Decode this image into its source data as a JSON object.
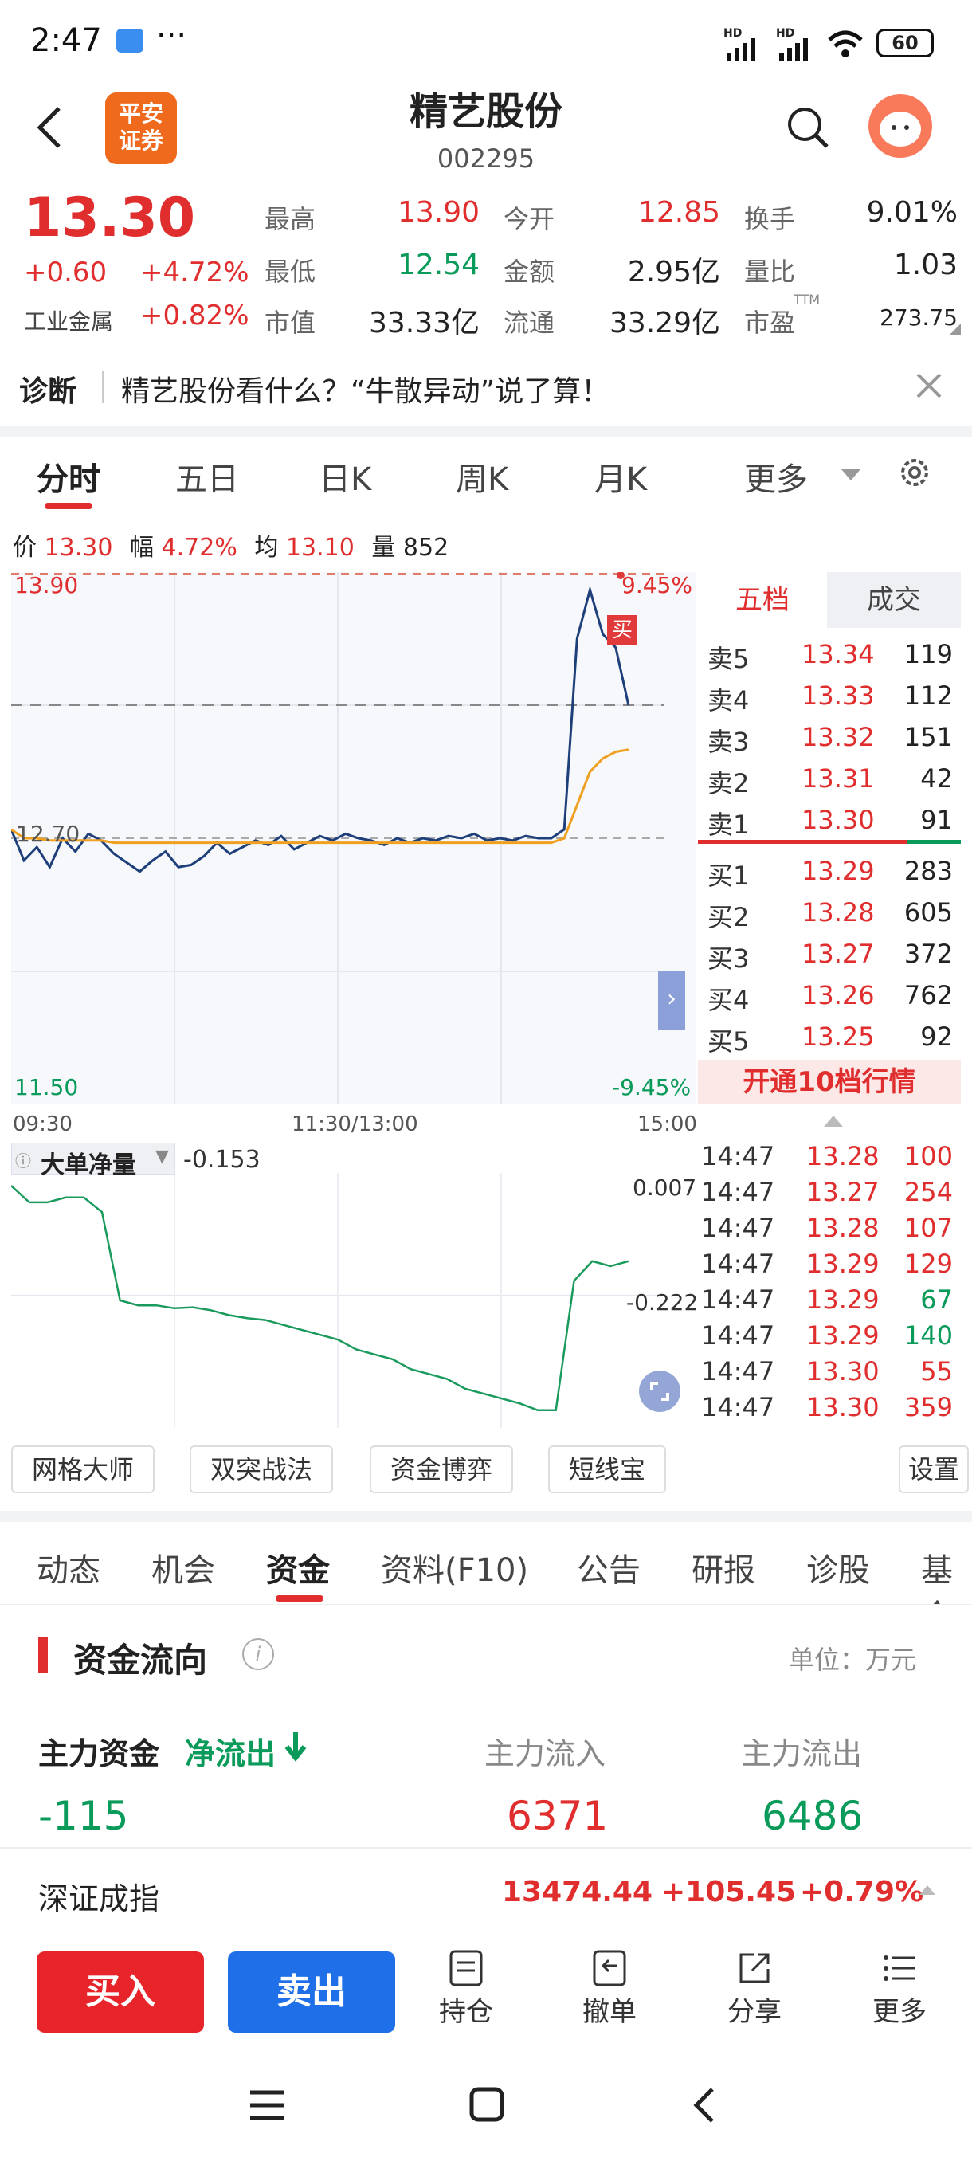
{
  "status": {
    "time": "2:47",
    "battery": "60",
    "dots": "···",
    "hd1": "HD",
    "hd2": "HD"
  },
  "header": {
    "logo_line1": "平安",
    "logo_line2": "证券",
    "name": "精艺股份",
    "code": "002295"
  },
  "quote": {
    "price": "13.30",
    "change": "+0.60",
    "change_pct": "+4.72%",
    "sector": "工业金属",
    "sector_pct": "+0.82%",
    "high_label": "最高",
    "high": "13.90",
    "open_label": "今开",
    "open": "12.85",
    "turnover_label": "换手",
    "turnover": "9.01%",
    "low_label": "最低",
    "low": "12.54",
    "amount_label": "金额",
    "amount": "2.95亿",
    "vr_label": "量比",
    "vr": "1.03",
    "mcap_label": "市值",
    "mcap": "33.33亿",
    "float_label": "流通",
    "float": "33.29亿",
    "pe_label": "市盈",
    "pe_sup": "TTM",
    "pe": "273.75"
  },
  "diag": {
    "label": "诊断",
    "text": "精艺股份看什么？“牛散异动”说了算！"
  },
  "chart_tabs": [
    "分时",
    "五日",
    "日K",
    "周K",
    "月K",
    "更多"
  ],
  "info_line": {
    "price_label": "价",
    "price": "13.30",
    "amp_label": "幅",
    "amp": "4.72%",
    "avg_label": "均",
    "avg": "13.10",
    "vol_label": "量",
    "vol": "852"
  },
  "chart_data": {
    "type": "line",
    "title": "",
    "y_top": "13.90",
    "y_mid": "12.70",
    "y_bottom": "11.50",
    "pct_top": "9.45%",
    "pct_bottom": "-9.45%",
    "ylim": [
      11.5,
      13.9
    ],
    "x_labels": [
      "09:30",
      "11:30/13:00",
      "15:00"
    ],
    "buy_marker": "买",
    "series": [
      {
        "name": "",
        "values": [
          12.74,
          12.6,
          12.66,
          12.57,
          12.7,
          12.64,
          12.72,
          12.69,
          12.63,
          12.59,
          12.55,
          12.6,
          12.64,
          12.57,
          12.58,
          12.62,
          12.68,
          12.63,
          12.66,
          12.69,
          12.67,
          12.71,
          12.65,
          12.68,
          12.71,
          12.69,
          12.72,
          12.7,
          12.69,
          12.67,
          12.7,
          12.68,
          12.7,
          12.69,
          12.71,
          12.7,
          12.72,
          12.69,
          12.7,
          12.69,
          12.71,
          12.7,
          12.7,
          12.74,
          13.6,
          13.82,
          13.62,
          13.56,
          13.3
        ]
      },
      {
        "name": "",
        "values": [
          12.74,
          12.7,
          12.7,
          12.69,
          12.69,
          12.69,
          12.69,
          12.69,
          12.68,
          12.68,
          12.68,
          12.68,
          12.68,
          12.68,
          12.68,
          12.68,
          12.68,
          12.68,
          12.68,
          12.68,
          12.68,
          12.68,
          12.68,
          12.68,
          12.68,
          12.68,
          12.68,
          12.68,
          12.68,
          12.68,
          12.68,
          12.68,
          12.68,
          12.68,
          12.68,
          12.68,
          12.68,
          12.68,
          12.68,
          12.68,
          12.68,
          12.68,
          12.68,
          12.7,
          12.85,
          13.0,
          13.06,
          13.09,
          13.1
        ]
      }
    ],
    "sub": {
      "label": "大单净量",
      "value": "-0.153",
      "top": "0.007",
      "bottom": "-0.222",
      "values": [
        0.007,
        -0.01,
        -0.01,
        -0.005,
        -0.005,
        -0.02,
        -0.11,
        -0.115,
        -0.115,
        -0.118,
        -0.117,
        -0.12,
        -0.125,
        -0.128,
        -0.13,
        -0.135,
        -0.14,
        -0.145,
        -0.15,
        -0.16,
        -0.165,
        -0.17,
        -0.18,
        -0.185,
        -0.19,
        -0.2,
        -0.205,
        -0.21,
        -0.215,
        -0.222,
        -0.222,
        -0.09,
        -0.07,
        -0.075,
        -0.07
      ]
    }
  },
  "orderbook": {
    "tab1": "五档",
    "tab2": "成交",
    "sells": [
      {
        "label": "卖5",
        "price": "13.34",
        "vol": "119"
      },
      {
        "label": "卖4",
        "price": "13.33",
        "vol": "112"
      },
      {
        "label": "卖3",
        "price": "13.32",
        "vol": "151"
      },
      {
        "label": "卖2",
        "price": "13.31",
        "vol": "42"
      },
      {
        "label": "卖1",
        "price": "13.30",
        "vol": "91"
      }
    ],
    "buys": [
      {
        "label": "买1",
        "price": "13.29",
        "vol": "283"
      },
      {
        "label": "买2",
        "price": "13.28",
        "vol": "605"
      },
      {
        "label": "买3",
        "price": "13.27",
        "vol": "372"
      },
      {
        "label": "买4",
        "price": "13.26",
        "vol": "762"
      },
      {
        "label": "买5",
        "price": "13.25",
        "vol": "92"
      }
    ],
    "promo": "开通10档行情"
  },
  "ticks": [
    {
      "t": "14:47",
      "p": "13.28",
      "v": "100"
    },
    {
      "t": "14:47",
      "p": "13.27",
      "v": "254"
    },
    {
      "t": "14:47",
      "p": "13.28",
      "v": "107"
    },
    {
      "t": "14:47",
      "p": "13.29",
      "v": "129"
    },
    {
      "t": "14:47",
      "p": "13.29",
      "v": "67"
    },
    {
      "t": "14:47",
      "p": "13.29",
      "v": "140"
    },
    {
      "t": "14:47",
      "p": "13.30",
      "v": "55"
    },
    {
      "t": "14:47",
      "p": "13.30",
      "v": "359"
    }
  ],
  "tools": [
    "网格大师",
    "双突战法",
    "资金博弈",
    "短线宝",
    "设置"
  ],
  "bottom_tabs": [
    "动态",
    "机会",
    "资金",
    "资料(F10)",
    "公告",
    "研报",
    "诊股",
    "基金"
  ],
  "fund": {
    "title": "资金流向",
    "unit": "单位：万元",
    "main_label": "主力资金",
    "net_label": "净流出",
    "net_value": "-115",
    "in_label": "主力流入",
    "in_value": "6371",
    "out_label": "主力流出",
    "out_value": "6486"
  },
  "index": {
    "name": "深证成指",
    "value": "13474.44",
    "change": "+105.45",
    "pct": "+0.79%"
  },
  "actions": {
    "buy": "买入",
    "sell": "卖出",
    "position": "持仓",
    "cancel": "撤单",
    "share": "分享",
    "more": "更多"
  }
}
